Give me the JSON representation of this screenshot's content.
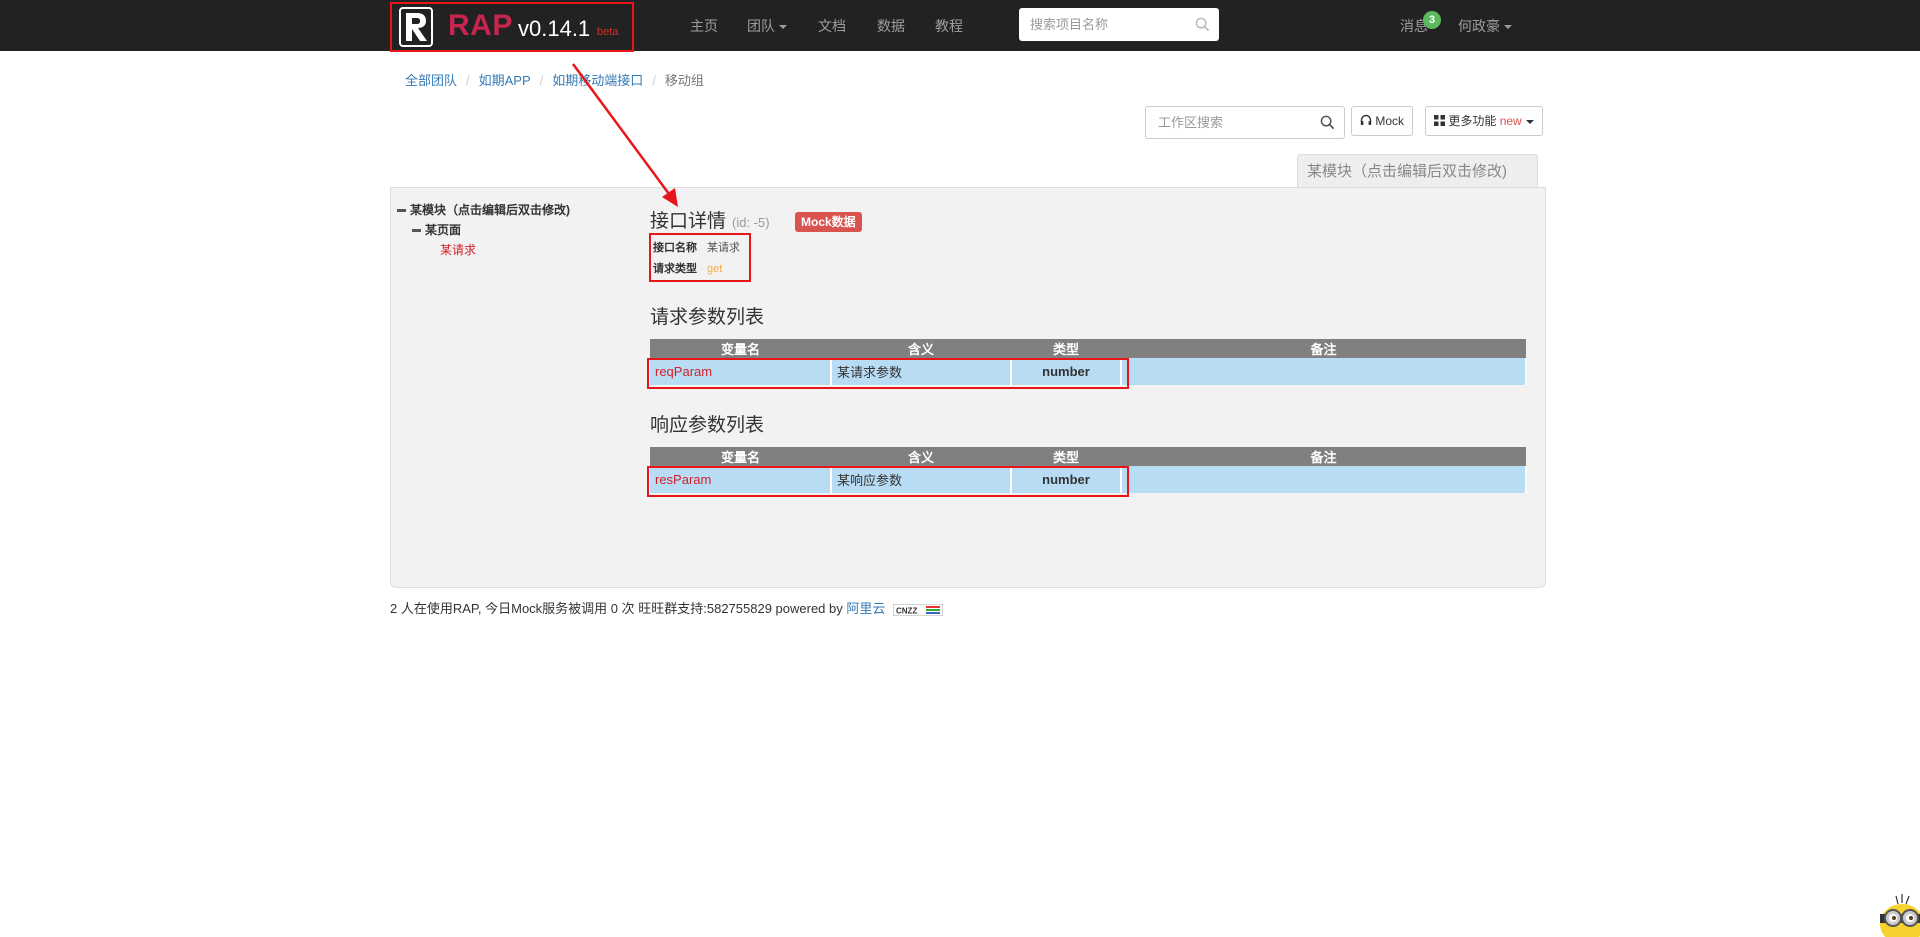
{
  "navbar": {
    "logo_text": "RAP",
    "version": "v0.14.1",
    "beta_label": "beta",
    "items": [
      {
        "label": "主页"
      },
      {
        "label": "团队"
      },
      {
        "label": "文档"
      },
      {
        "label": "数据"
      },
      {
        "label": "教程"
      }
    ],
    "search_placeholder": "搜索项目名称",
    "messages_label": "消息",
    "messages_count": "3",
    "user_name": "何政豪"
  },
  "breadcrumb": {
    "items": [
      "全部团队",
      "如期APP",
      "如期移动端接口"
    ],
    "current": "移动组"
  },
  "toolbar": {
    "search_placeholder": "工作区搜索",
    "mock_button": "Mock",
    "more_button": "更多功能",
    "more_new": "new"
  },
  "module_tab": "某模块（点击编辑后双击修改)",
  "tree": {
    "module": "某模块（点击编辑后双击修改)",
    "page": "某页面",
    "request": "某请求"
  },
  "detail": {
    "title": "接口详情",
    "id_text": "(id: -5)",
    "mock_label": "Mock数据",
    "name_key": "接口名称",
    "name_value": "某请求",
    "type_key": "请求类型",
    "type_value": "get"
  },
  "request_params": {
    "title": "请求参数列表",
    "headers": [
      "变量名",
      "含义",
      "类型",
      "备注"
    ],
    "rows": [
      {
        "name": "reqParam",
        "meaning": "某请求参数",
        "type": "number",
        "note": ""
      }
    ]
  },
  "response_params": {
    "title": "响应参数列表",
    "headers": [
      "变量名",
      "含义",
      "类型",
      "备注"
    ],
    "rows": [
      {
        "name": "resParam",
        "meaning": "某响应参数",
        "type": "number",
        "note": ""
      }
    ]
  },
  "footer": {
    "text": "2 人在使用RAP, 今日Mock服务被调用 0 次  旺旺群支持:582755829  powered by",
    "link": "阿里云",
    "badge": "CNZZ"
  },
  "colors": {
    "navbar_bg": "#222222",
    "brand": "#c7254e",
    "annotation": "#e8151b",
    "table_header": "#808080",
    "table_row": "#b9dcf5",
    "mock_label": "#d9534f",
    "message_badge": "#5cb85c"
  }
}
